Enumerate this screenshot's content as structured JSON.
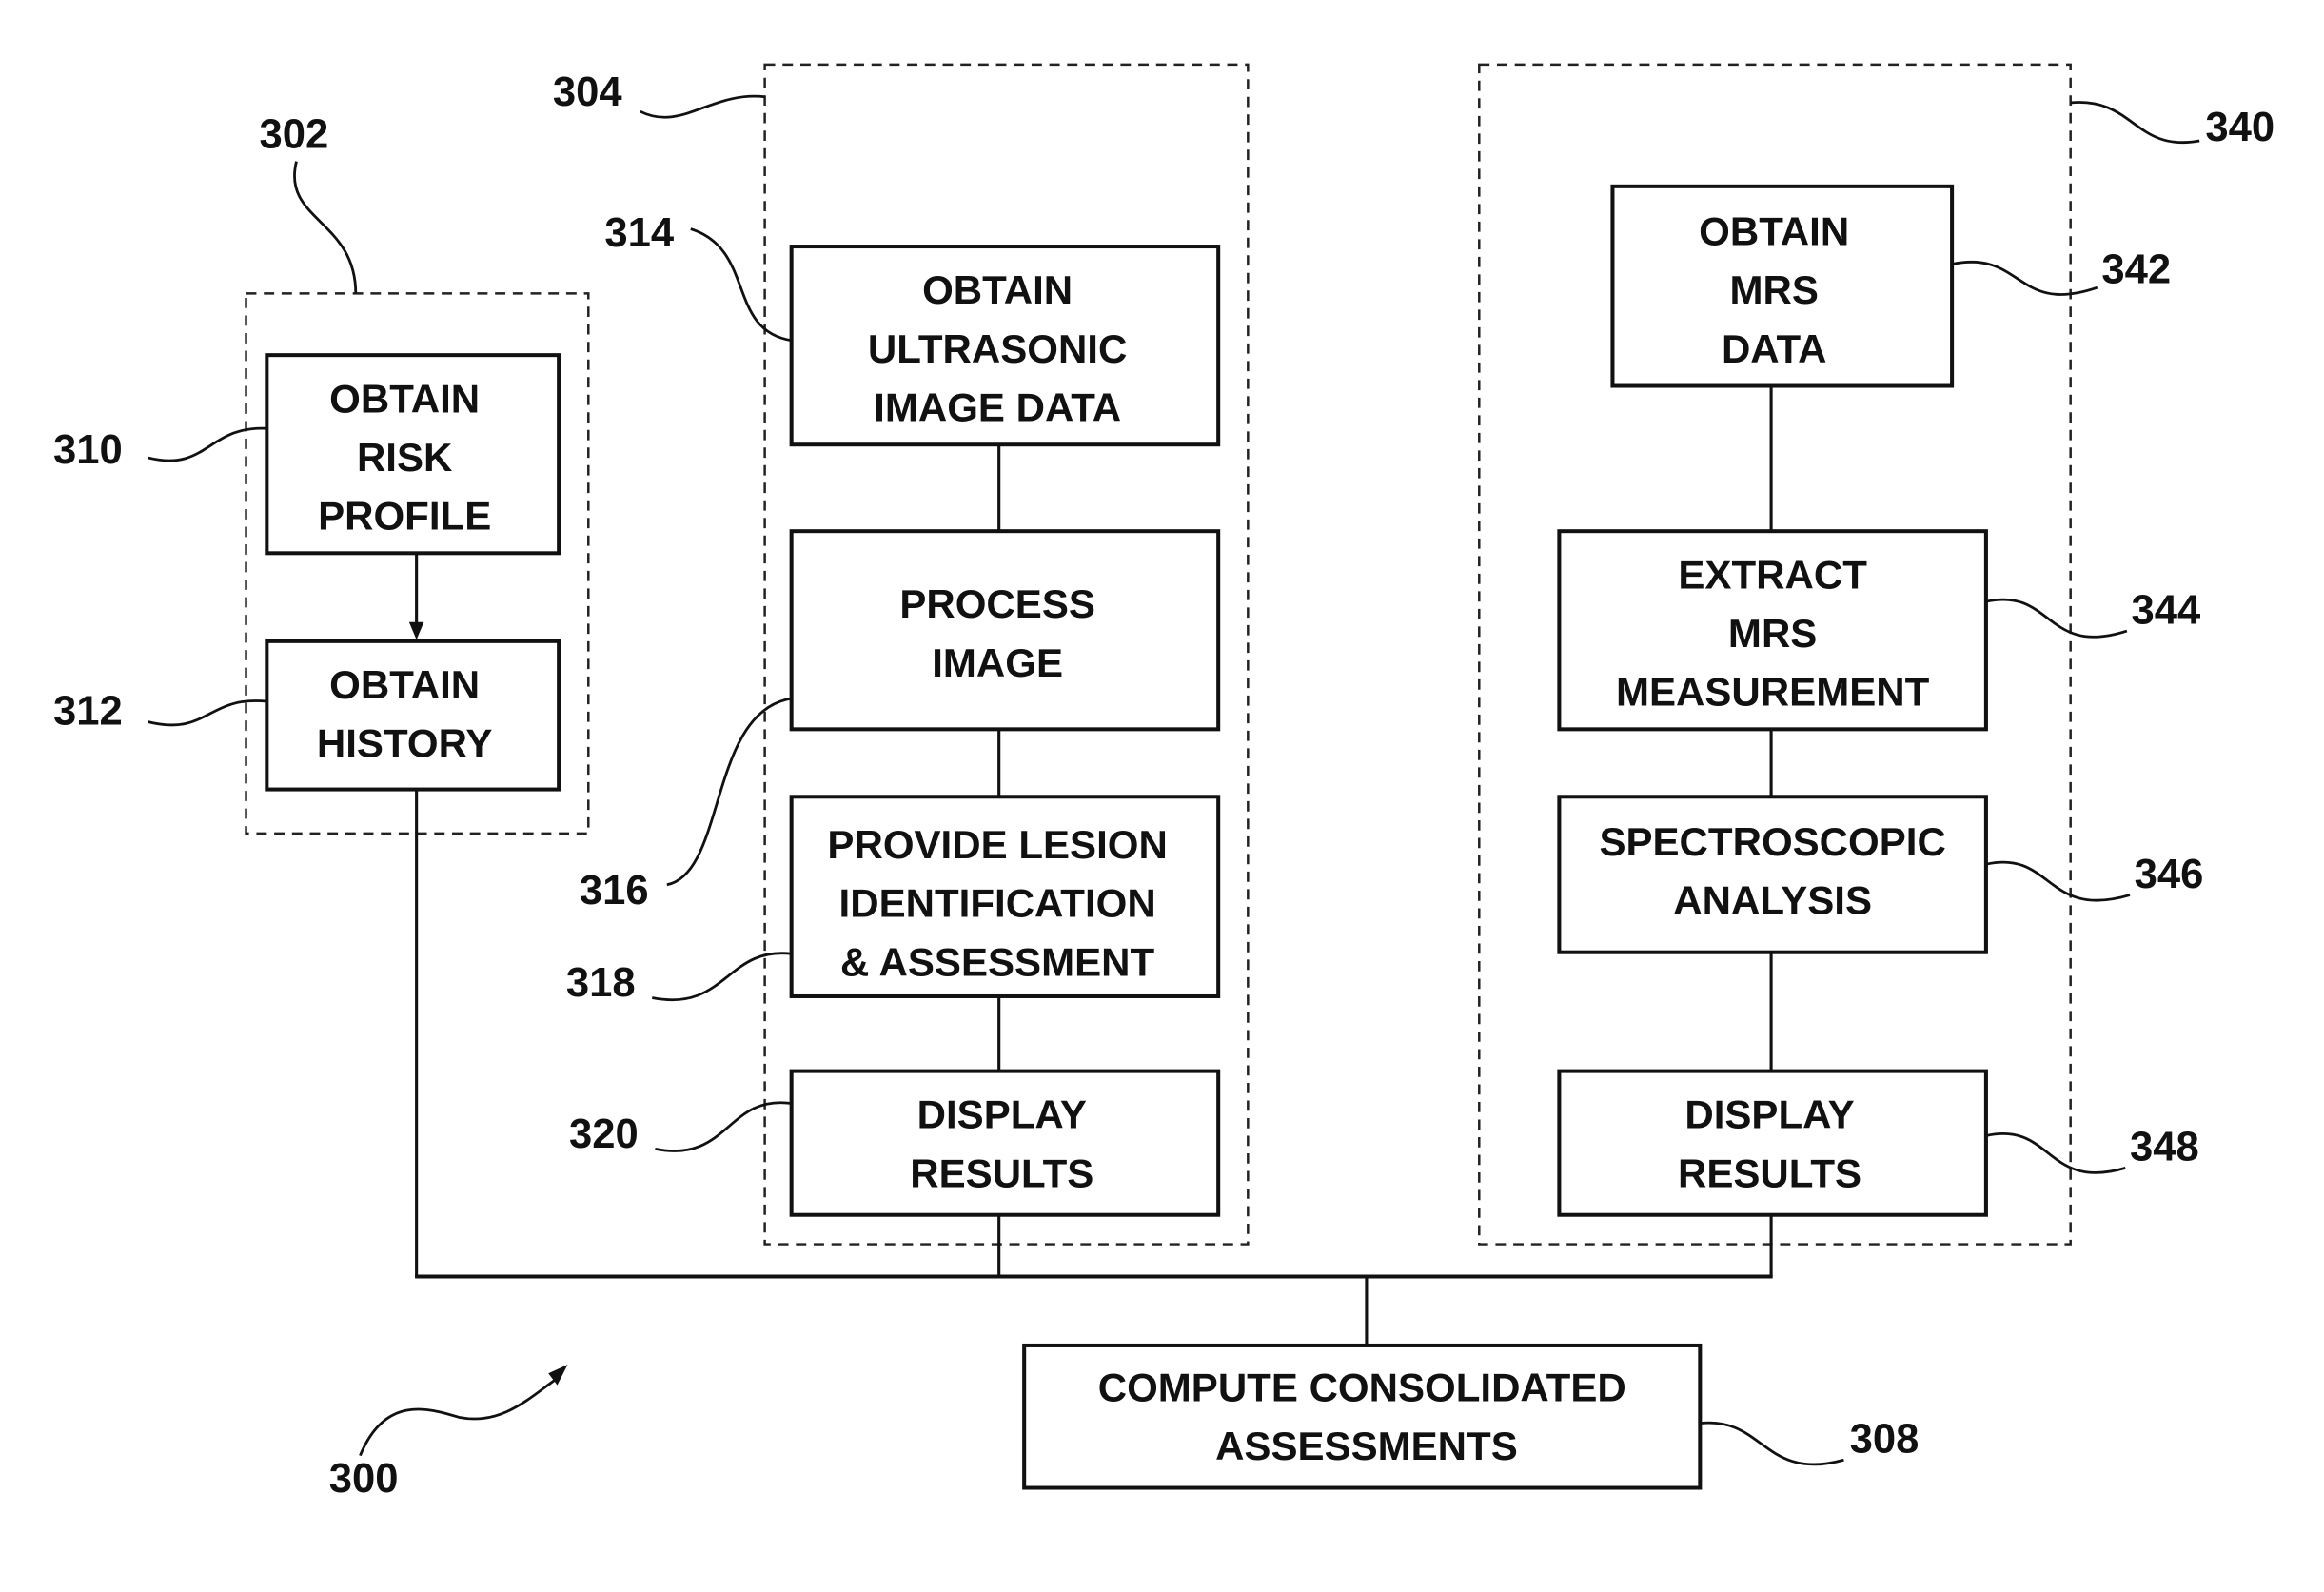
{
  "figure": {
    "reference": "300",
    "groups": [
      {
        "id": "302",
        "ref": "302"
      },
      {
        "id": "304",
        "ref": "304"
      },
      {
        "id": "340",
        "ref": "340"
      }
    ],
    "steps": {
      "s310": {
        "ref": "310",
        "lines": [
          "OBTAIN",
          "RISK",
          "PROFILE"
        ]
      },
      "s312": {
        "ref": "312",
        "lines": [
          "OBTAIN",
          "HISTORY"
        ]
      },
      "s314": {
        "ref": "314",
        "lines": [
          "OBTAIN",
          "ULTRASONIC",
          "IMAGE DATA"
        ]
      },
      "s316": {
        "ref": "316",
        "lines": [
          "PROCESS",
          "IMAGE"
        ]
      },
      "s318": {
        "ref": "318",
        "lines": [
          "PROVIDE LESION",
          "IDENTIFICATION",
          "& ASSESSMENT"
        ]
      },
      "s320": {
        "ref": "320",
        "lines": [
          "DISPLAY",
          "RESULTS"
        ]
      },
      "s342": {
        "ref": "342",
        "lines": [
          "OBTAIN",
          "MRS",
          "DATA"
        ]
      },
      "s344": {
        "ref": "344",
        "lines": [
          "EXTRACT",
          "MRS",
          "MEASUREMENT"
        ]
      },
      "s346": {
        "ref": "346",
        "lines": [
          "SPECTROSCOPIC",
          "ANALYSIS"
        ]
      },
      "s348": {
        "ref": "348",
        "lines": [
          "DISPLAY",
          "RESULTS"
        ]
      },
      "s308": {
        "ref": "308",
        "lines": [
          "COMPUTE CONSOLIDATED",
          "ASSESSMENTS"
        ]
      }
    }
  }
}
